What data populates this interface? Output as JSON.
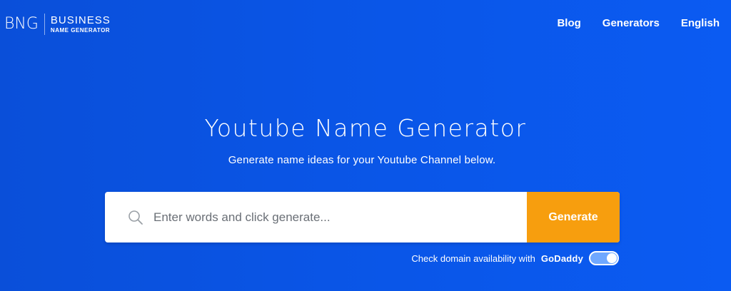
{
  "logo": {
    "mark": "BNG",
    "line1": "BUSINESS",
    "line2": "NAME GENERATOR"
  },
  "nav": {
    "items": [
      {
        "label": "Blog"
      },
      {
        "label": "Generators"
      },
      {
        "label": "English"
      }
    ]
  },
  "hero": {
    "title": "Youtube Name Generator",
    "subtitle": "Generate name ideas for your Youtube Channel below."
  },
  "search": {
    "placeholder": "Enter words and click generate...",
    "value": "",
    "button_label": "Generate",
    "icon": "search-icon"
  },
  "domain_check": {
    "label": "Check domain availability with",
    "brand": "GoDaddy",
    "toggle_state": "on"
  },
  "colors": {
    "background": "#0a55e6",
    "accent": "#f79e0e",
    "toggle": "#6fa8ff",
    "text": "#ffffff"
  }
}
